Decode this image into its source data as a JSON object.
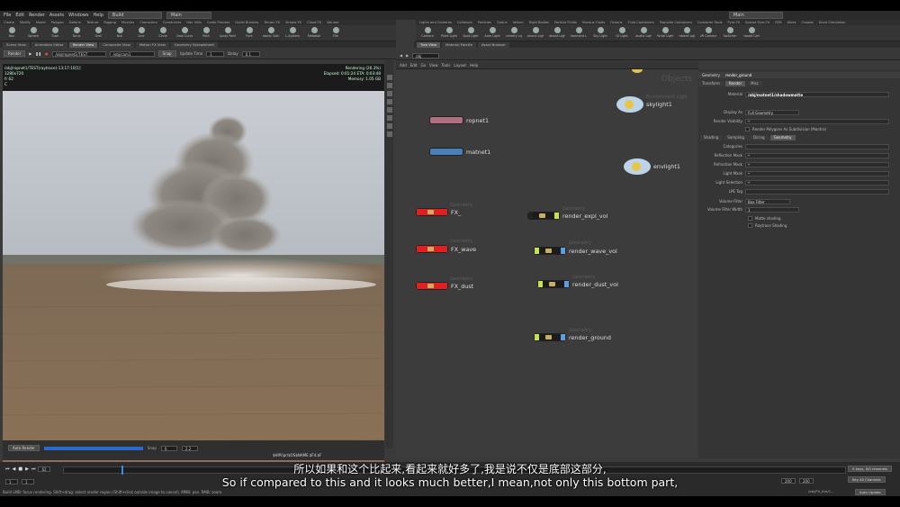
{
  "menu": {
    "items": [
      "File",
      "Edit",
      "Render",
      "Assets",
      "Windows",
      "Help"
    ],
    "desktop": "Build",
    "desktop_right": "Main",
    "desktop_far": "Main"
  },
  "shelf_left": {
    "tabs": [
      "Create",
      "Modify",
      "Model",
      "Polygon",
      "Deform",
      "Texture",
      "Rigging",
      "Muscles",
      "Characters",
      "Constraints",
      "Hair Utils",
      "Guide Process",
      "Guide Brushes",
      "Terrain FX",
      "Simple FX",
      "Cloud FX",
      "Volume"
    ],
    "tools": [
      "Box",
      "Sphere",
      "Tube",
      "Torus",
      "Grid",
      "Null",
      "Line",
      "Circle",
      "Draw Curve",
      "Path",
      "Spray Paint",
      "Font",
      "Platonic Solids",
      "L-System",
      "Metaball",
      "File"
    ]
  },
  "shelf_right": {
    "tabs": [
      "Lights and Cameras",
      "Collisions",
      "Particles",
      "Grains",
      "Vellum",
      "Rigid Bodies",
      "Particle Fluids",
      "Viscous Fluids",
      "Oceans",
      "Fluid Containers",
      "Populate Containers",
      "Container Tools",
      "Pyro FX",
      "Sparse Pyro FX",
      "FEM",
      "Wires",
      "Crowds",
      "Drive Simulation"
    ],
    "tools": [
      "Camera",
      "Point Light",
      "Spot Light",
      "Area Light",
      "Geometry Light",
      "Volume Light",
      "Distant Light",
      "Environment Light",
      "Sky Light",
      "GI Light",
      "Caustic Light",
      "Portal Light",
      "Ambient Light",
      "VR Camera",
      "Switcher",
      "Gamepad Camera"
    ]
  },
  "left_panes": [
    "Scene View",
    "Animation Editor",
    "Render View",
    "Composite View",
    "Motion FX View",
    "Geometry Spreadsheet"
  ],
  "render_strip": {
    "render_button": "Render",
    "path1": "/obj/ropnet1/TEST",
    "path2": "/obj/cam1",
    "snapshot": "Snap",
    "update_time_label": "Update Time",
    "update_time": "1",
    "delay_label": "Delay",
    "delay": "0.1"
  },
  "render_info": {
    "path": "/obj/ropnet1/TEST(raytrace)-13:17:10[1]",
    "res": "1280x720",
    "frame": "fr 62",
    "c": "C",
    "status": "Rendering (26.3%)",
    "elapsed": "Elapsed: 0:01:24",
    "eta": "ETA: 0:03:48",
    "memory_label": "Memory:",
    "memory": "1.05 GB",
    "hint": "Ctrl+Left to show detailed pixel information. Shift+Ctrl+Left to inspect base material in the parameter dialog."
  },
  "render_controls": {
    "auto_render": "Auto Render",
    "snap_label": "Snap",
    "snap_value": "0",
    "zoom": "2.2",
    "output": "$HIP/ipr/$OS$NAME.$F4.$F"
  },
  "network_tabs": [
    "Tree View",
    "Material Palette",
    "Asset Browser"
  ],
  "network_path": "obj",
  "network_menu": [
    "Add",
    "Edit",
    "Go",
    "View",
    "Tools",
    "Layout",
    "Help"
  ],
  "network_label": "Objects",
  "nodes": {
    "ropnet": "ropnet1",
    "matnet": "matnet1",
    "skylight_type": "Environment Light",
    "skylight": "skylight1",
    "envlight": "envlight1",
    "geometry_type": "Geometry",
    "fx": "FX_",
    "fx_wave": "FX_wave",
    "fx_dust": "FX_dust",
    "render_expl": "render_expl_vol",
    "render_wave": "render_wave_vol",
    "render_dust": "render_dust_vol",
    "render_ground": "render_ground"
  },
  "params": {
    "header_type": "Geometry",
    "header_name": "render_ground",
    "tabs": [
      "Transform",
      "Render",
      "Misc"
    ],
    "material_label": "Material",
    "material": "/obj/matnet1/shadowmatte",
    "display_as_label": "Display As",
    "display_as": "Full Geometry",
    "visibility_label": "Render Visibility",
    "visibility": "*",
    "subdiv": "Render Polygons As Subdivision (Mantra)",
    "subtabs": [
      "Shading",
      "Sampling",
      "Dicing",
      "Geometry"
    ],
    "rows": [
      {
        "label": "Categories",
        "value": ""
      },
      {
        "label": "Reflection Mask",
        "value": "*"
      },
      {
        "label": "Refraction Mask",
        "value": "*"
      },
      {
        "label": "Light Mask",
        "value": "*"
      },
      {
        "label": "Light Selection",
        "value": "*"
      },
      {
        "label": "LPE Tag",
        "value": ""
      }
    ],
    "volume_filter_label": "Volume Filter",
    "volume_filter": "Box Filter",
    "volume_filter_width_label": "Volume Filter Width",
    "volume_filter_width": "1",
    "matte": "Matte shading",
    "raytrace": "Raytrace Shading"
  },
  "timeline": {
    "frame": "62",
    "start": "1",
    "end": "1",
    "range_end": "200",
    "range_end2": "200",
    "keys_label": "0 keys, 0/0 channels",
    "channels": "Key All Channels",
    "auto_update": "Auto Update",
    "path": "/obj/FX_the/C..."
  },
  "status": "Build LMB: focus rendering. Shift+drag: select render region (Shift+click outside image to cancel). MMB: pan. RMB: zoom.",
  "subtitles": {
    "chinese": "所以如果和这个比起来,看起来就好多了,我是说不仅是底部这部分,",
    "english": "So if compared to this and it looks much better,I mean,not only this bottom part,"
  }
}
